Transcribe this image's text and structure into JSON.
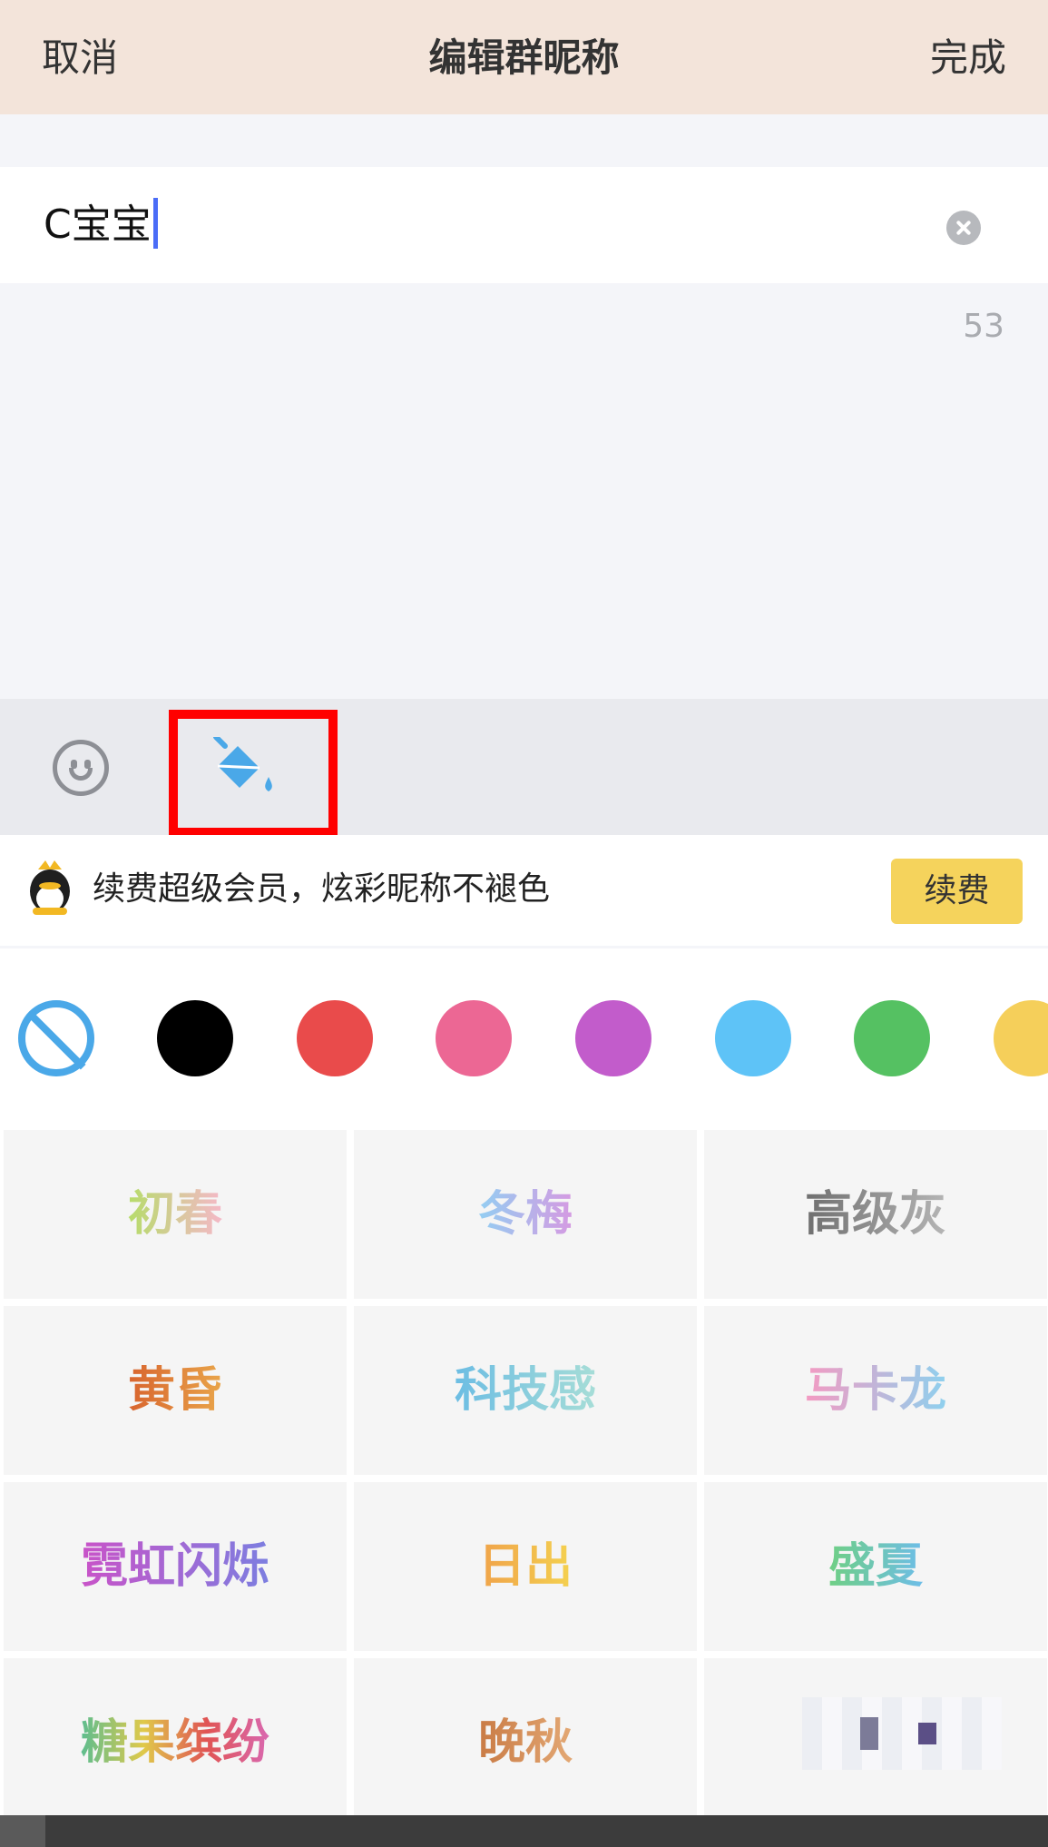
{
  "nav": {
    "cancel_label": "取消",
    "title": "编辑群昵称",
    "done_label": "完成"
  },
  "input": {
    "value": "C宝宝",
    "remaining": "53"
  },
  "toolbar": {
    "emoji_icon": "emoji-face-icon",
    "color_icon": "paint-bucket-icon"
  },
  "promo": {
    "text": "续费超级会员，炫彩昵称不褪色",
    "button_label": "续费",
    "icon": "qq-vip-penguin-icon"
  },
  "colors": {
    "swatches": [
      {
        "name": "none",
        "hex": "#4aa8e8"
      },
      {
        "name": "black",
        "hex": "#000000"
      },
      {
        "name": "red",
        "hex": "#e94b4b"
      },
      {
        "name": "pink",
        "hex": "#ec6794"
      },
      {
        "name": "purple",
        "hex": "#c25ccb"
      },
      {
        "name": "blue",
        "hex": "#5ec3f7"
      },
      {
        "name": "green",
        "hex": "#55c162"
      },
      {
        "name": "yellow",
        "hex": "#f5cf5a"
      }
    ]
  },
  "styles": [
    {
      "label": "初春",
      "colors": [
        "#b6dc6a",
        "#f5b8c8"
      ]
    },
    {
      "label": "冬梅",
      "colors": [
        "#93cef2",
        "#d59ae2"
      ]
    },
    {
      "label": "高级灰",
      "colors": [
        "#6f6f6f",
        "#b5b5b5"
      ]
    },
    {
      "label": "黄昏",
      "colors": [
        "#d8642e",
        "#e9a54a"
      ]
    },
    {
      "label": "科技感",
      "colors": [
        "#6cbde3",
        "#a6ddd7"
      ]
    },
    {
      "label": "马卡龙",
      "colors": [
        "#f49ac2",
        "#8ed0ee"
      ]
    },
    {
      "label": "霓虹闪烁",
      "colors": [
        "#c953c8",
        "#7c7ee0"
      ]
    },
    {
      "label": "日出",
      "colors": [
        "#f0a24a",
        "#f4d14f"
      ]
    },
    {
      "label": "盛夏",
      "colors": [
        "#6fcf84",
        "#6dbde8"
      ]
    },
    {
      "label": "糖果缤纷",
      "colors": [
        "#5dbd8f",
        "#e0c94a",
        "#e05454",
        "#d968b0"
      ]
    },
    {
      "label": "晚秋",
      "colors": [
        "#c97b45",
        "#e3a874"
      ]
    }
  ]
}
